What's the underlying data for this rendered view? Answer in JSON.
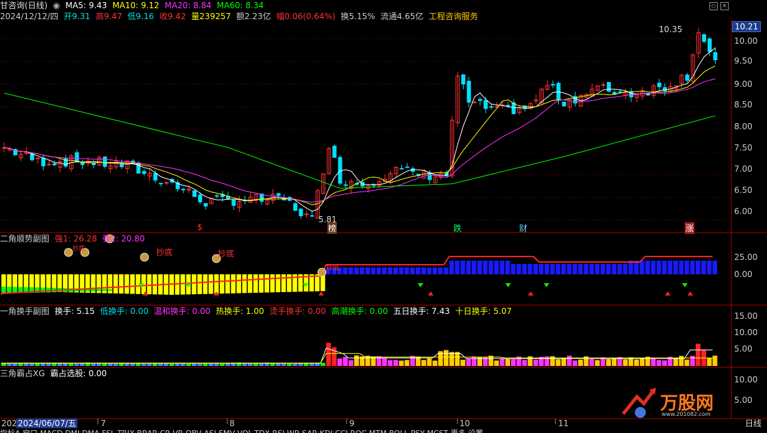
{
  "colors": {
    "up": "#ff3333",
    "down": "#00e0ff",
    "ma5": "#ffffff",
    "ma10": "#ffff00",
    "ma20": "#ff33ff",
    "ma60": "#00ff00",
    "grid": "#5a0000",
    "frame": "#aa0000",
    "yellow": "#ffff00",
    "magenta": "#ff33ff",
    "blue": "#1a1aff",
    "green": "#00ff00"
  },
  "header": {
    "name": "甘咨询(日线)",
    "ma5": "MA5: 9.43",
    "ma10": "MA10: 9.12",
    "ma20": "MA20: 8.84",
    "ma60": "MA60: 8.34",
    "date": "2024/12/12/四",
    "open": "开9.31",
    "high": "高9.47",
    "low": "低9.16",
    "close": "收9.42",
    "volume": "量239257",
    "amount": "额2.23亿",
    "change": "幅0.06(0.64%)",
    "turnover": "换5.15%",
    "float": "流通4.65亿",
    "sector": "工程咨询服务"
  },
  "price_axis": {
    "ticks": [
      "10.00",
      "9.50",
      "9.00",
      "8.50",
      "8.00",
      "7.50",
      "7.00",
      "6.50",
      "6.00"
    ],
    "current": "10.21"
  },
  "annotations": {
    "high_label": "10.35",
    "low_label": "5.81"
  },
  "events": {
    "s": "$",
    "bang": "榜",
    "die": "跌",
    "cai": "财",
    "zhang": "涨"
  },
  "panel2": {
    "title": "二角顺势副图",
    "q1": "强1: 26.28",
    "q2": "强2: 20.80",
    "axis": [
      "25.00",
      "0.00"
    ],
    "signals": [
      "抄底",
      "抄底",
      "抄底"
    ],
    "bag_label": "抄底"
  },
  "panel3": {
    "title": "一角换手副图",
    "turn": "换手: 5.15",
    "low": "低换手: 0.00",
    "mild": "温和换手: 0.00",
    "hot": "热换手: 1.00",
    "burn": "烫手换手: 0.00",
    "peak": "高潮换手: 0.00",
    "d5": "五日换手: 7.43",
    "d10": "十日换手: 5.07",
    "axis": [
      "15.00",
      "10.00",
      "5.00"
    ]
  },
  "panel4": {
    "title": "三角霸占XG",
    "select": "霸占选股: 0.00",
    "axis": [
      "10.00",
      "5.00"
    ]
  },
  "time_axis": {
    "date_box": "2024/06/07/五",
    "left": "202",
    "months": [
      "7",
      "8",
      "9",
      "10",
      "11"
    ],
    "right_label": "日线"
  },
  "logo": {
    "text": "万股网",
    "site": "www.201082.com"
  },
  "bottom_tabs": "指标A 窗口 MACD DMI DMA FSL TRIX BRAR CR VR OBV ASI EMV VOL-TDX RSI WR SAR KDJ CCI ROC MTM BOLL PSY MCST 更多 设置"
}
